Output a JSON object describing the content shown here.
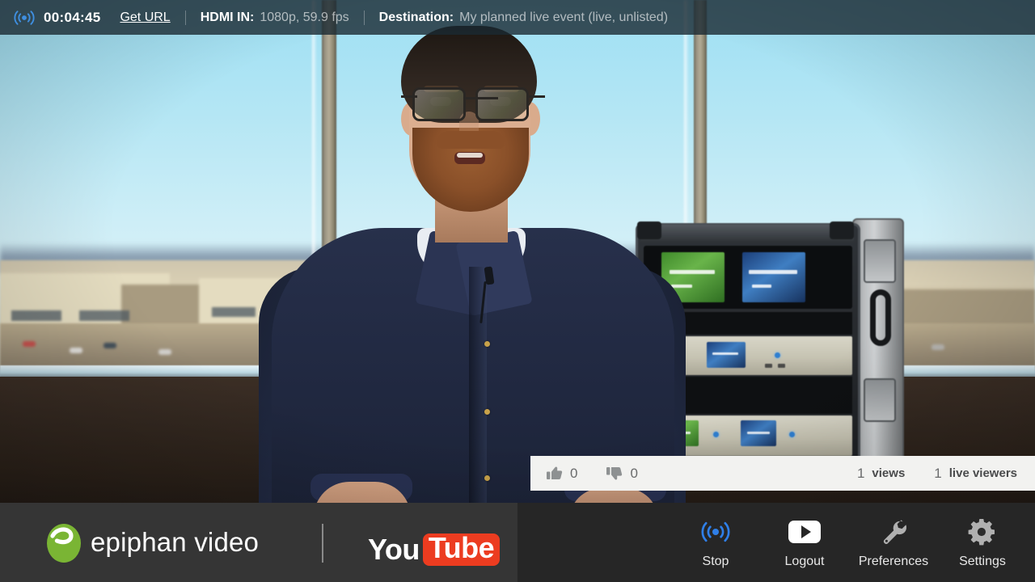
{
  "top_bar": {
    "broadcast_icon": "broadcast-icon",
    "timer": "00:04:45",
    "get_url_label": "Get URL",
    "hdmi_label": "HDMI IN:",
    "hdmi_value": "1080p, 59.9 fps",
    "destination_label": "Destination:",
    "destination_value": "My planned live event (live, unlisted)",
    "background_color": "#1a2932",
    "text_color": "#ffffff",
    "muted_text_color": "#9fb0b8"
  },
  "stats_bar": {
    "thumbs_up_icon": "thumbs-up-icon",
    "likes_count": "0",
    "thumbs_down_icon": "thumbs-down-icon",
    "dislikes_count": "0",
    "views_count": "1",
    "views_label": "views",
    "live_viewers_count": "1",
    "live_viewers_label": "live viewers",
    "background_color": "#f2f2f0",
    "text_color": "#5f6061"
  },
  "bottom_bar": {
    "brand_name": "epiphan video",
    "brand_mark_color": "#7ab534",
    "brand_panel_color": "#353535",
    "bar_color": "#262626",
    "youtube_word_1": "You",
    "youtube_word_2": "Tube",
    "youtube_red": "#ec3c20",
    "buttons": [
      {
        "label": "Stop",
        "icon": "broadcast-icon",
        "icon_color": "#2f7fe8"
      },
      {
        "label": "Logout",
        "icon": "youtube-play-icon",
        "icon_color": "#ffffff"
      },
      {
        "label": "Preferences",
        "icon": "wrench-icon",
        "icon_color": "#b0b0b0"
      },
      {
        "label": "Settings",
        "icon": "gear-icon",
        "icon_color": "#b0b0b0"
      }
    ]
  },
  "video": {
    "scene_description": "Live camera preview of a bearded presenter in a dark navy shirt standing in front of office windows with an equipment flight case at right"
  }
}
